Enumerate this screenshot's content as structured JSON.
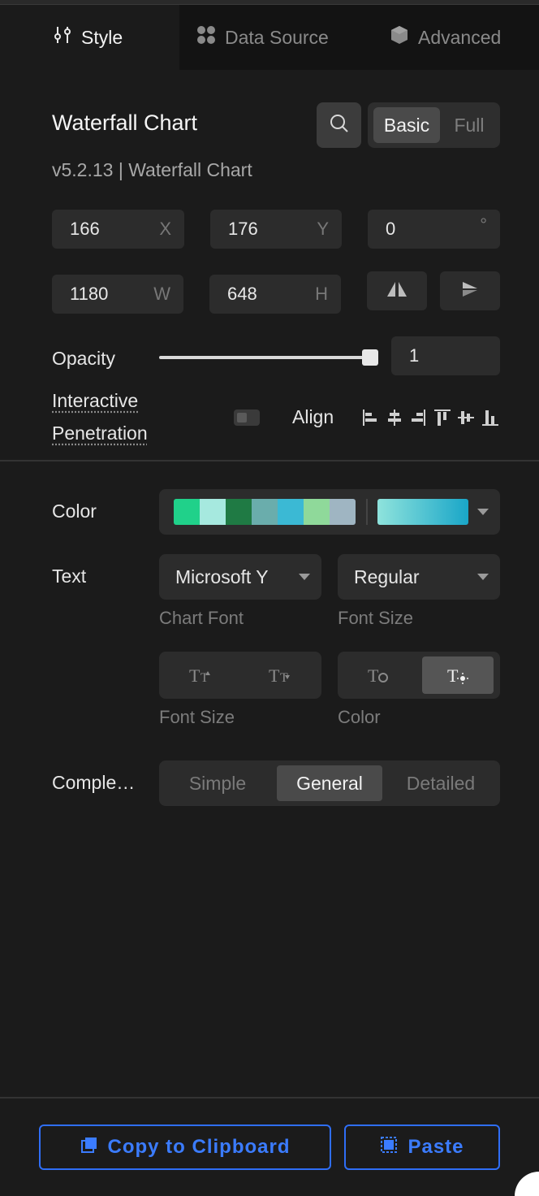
{
  "tabs": [
    {
      "label": "Style",
      "icon": "sliders-icon",
      "active": true
    },
    {
      "label": "Data Source",
      "icon": "dots-grid-icon",
      "active": false
    },
    {
      "label": "Advanced",
      "icon": "cube-icon",
      "active": false
    }
  ],
  "header": {
    "title": "Waterfall Chart",
    "subtitle": "v5.2.13 | Waterfall Chart",
    "mode_options": [
      "Basic",
      "Full"
    ],
    "mode_selected": "Basic"
  },
  "position": {
    "x": {
      "value": "166",
      "unit": "X"
    },
    "y": {
      "value": "176",
      "unit": "Y"
    },
    "rotation": {
      "value": "0",
      "unit": "°"
    },
    "w": {
      "value": "1180",
      "unit": "W"
    },
    "h": {
      "value": "648",
      "unit": "H"
    }
  },
  "opacity": {
    "label": "Opacity",
    "value": "1",
    "level": 1.0
  },
  "interactive": {
    "label_line1": "Interactive",
    "label_line2": "Penetration",
    "enabled": false
  },
  "align": {
    "label": "Align"
  },
  "color": {
    "label": "Color",
    "palette": [
      "#20d18a",
      "#a6e9df",
      "#1f7a44",
      "#6aadac",
      "#3bb9d4",
      "#8fd99a",
      "#9fb5c2"
    ],
    "gradient_from": "#8fe3dc",
    "gradient_to": "#19a6c8"
  },
  "text": {
    "label": "Text",
    "font_value": "Microsoft Y",
    "font_caption": "Chart Font",
    "weight_value": "Regular",
    "weight_caption": "Font Size",
    "size_caption": "Font Size",
    "color_caption": "Color"
  },
  "complexity": {
    "label": "Comple…",
    "options": [
      "Simple",
      "General",
      "Detailed"
    ],
    "selected": "General"
  },
  "footer": {
    "copy_label": "Copy to Clipboard",
    "paste_label": "Paste",
    "accent": "#2f6ef6"
  }
}
